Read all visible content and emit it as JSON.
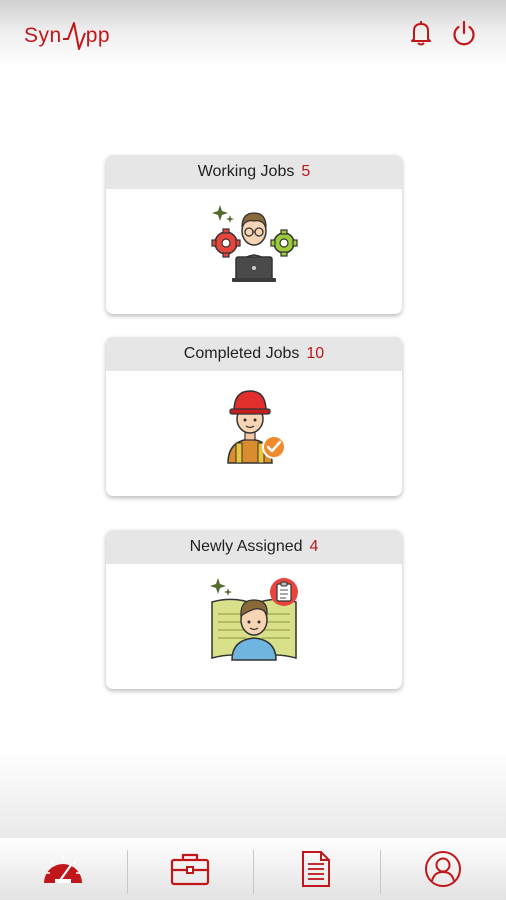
{
  "app": {
    "logo_left": "Syn",
    "logo_right": "pp",
    "brand_color": "#c0171b"
  },
  "header": {
    "icons": [
      "bell-icon",
      "power-icon"
    ]
  },
  "cards": [
    {
      "title": "Working Jobs",
      "count": "5",
      "illustration": "developer-laptop-gears-illustration"
    },
    {
      "title": "Completed Jobs",
      "count": "10",
      "illustration": "worker-hardhat-check-illustration"
    },
    {
      "title": "Newly Assigned",
      "count": "4",
      "illustration": "person-assigned-document-illustration"
    }
  ],
  "tabbar": {
    "tabs": [
      "dashboard-gauge-icon",
      "briefcase-icon",
      "document-icon",
      "profile-icon"
    ],
    "active": "dashboard-gauge-icon"
  }
}
